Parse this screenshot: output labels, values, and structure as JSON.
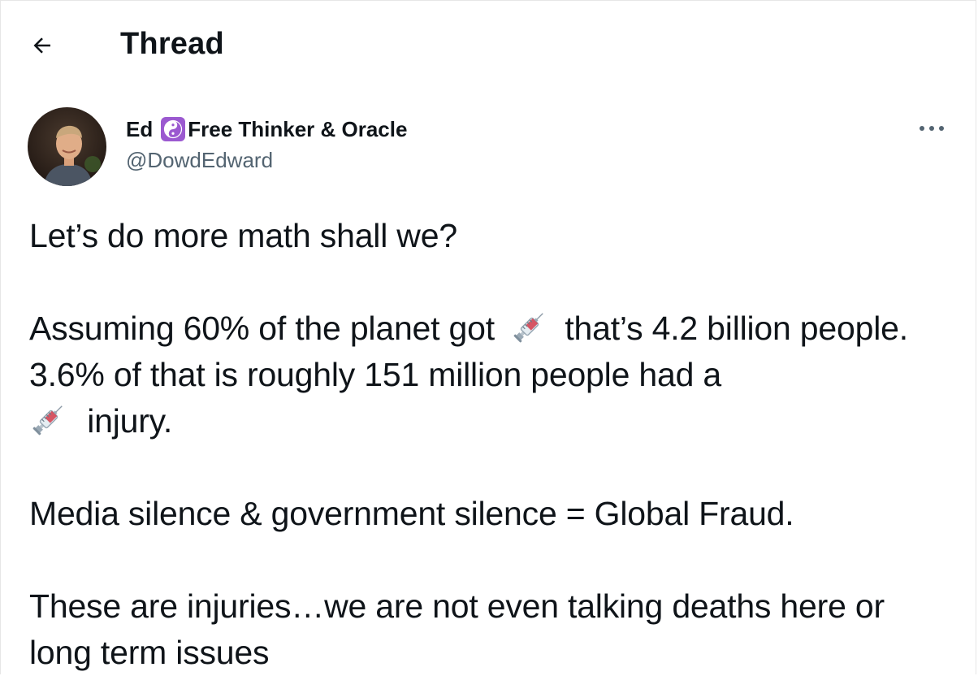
{
  "header": {
    "back_icon": "arrow-left-icon",
    "title": "Thread"
  },
  "author": {
    "name": "Ed",
    "name_emoji": "yin-yang-emoji",
    "name_suffix": "Free Thinker & Oracle",
    "handle": "@DowdEdward",
    "avatar": "profile-photo",
    "more_icon": "more-horizontal-icon"
  },
  "tweet": {
    "line1": "Let’s do more math shall we?",
    "p2_part1": "Assuming 60% of the planet got",
    "p2_part2": "that’s 4.2 billion people. 3.6% of that is roughly 151 million people had a",
    "p2_part3": "injury.",
    "syringe_icon": "syringe-emoji",
    "p3": "Media silence & government silence = Global Fraud.",
    "p4": "These are injuries…we are not even talking deaths here or long term issues"
  },
  "colors": {
    "text": "#0f1419",
    "secondary": "#536471",
    "emoji_purple": "#9b59d0"
  }
}
